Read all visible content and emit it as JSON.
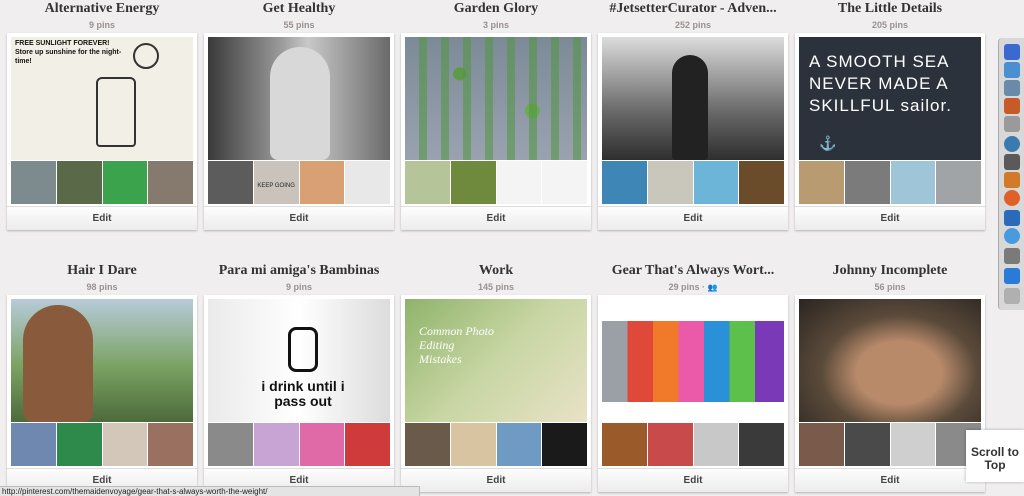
{
  "boards": [
    {
      "title": "Alternative Energy",
      "pins": "9 pins",
      "edit": "Edit",
      "cover_text": "FREE SUNLIGHT FOREVER! Store up sunshine for the night-time!"
    },
    {
      "title": "Get Healthy",
      "pins": "55 pins",
      "edit": "Edit",
      "thumb_text": "KEEP GOING"
    },
    {
      "title": "Garden Glory",
      "pins": "3 pins",
      "edit": "Edit"
    },
    {
      "title": "#JetsetterCurator - Adven...",
      "pins": "252 pins",
      "edit": "Edit"
    },
    {
      "title": "The Little Details",
      "pins": "205 pins",
      "edit": "Edit",
      "cover_text": "A SMOOTH SEA NEVER MADE A SKILLFUL sailor."
    },
    {
      "title": "Hair I Dare",
      "pins": "98 pins",
      "edit": "Edit"
    },
    {
      "title": "Para mi amiga's Bambinas",
      "pins": "9 pins",
      "edit": "Edit",
      "cover_text": "i drink until i pass out"
    },
    {
      "title": "Work",
      "pins": "145 pins",
      "edit": "Edit",
      "cover_text": "Common Photo Editing Mistakes"
    },
    {
      "title": "Gear That's Always Wort...",
      "pins": "29 pins ·",
      "edit": "Edit"
    },
    {
      "title": "Johnny Incomplete",
      "pins": "56 pins",
      "edit": "Edit"
    }
  ],
  "scroll_to_top": "Scroll to Top",
  "status_url": "http://pinterest.com/themaidenvoyage/gear-that-s-always-worth-the-weight/",
  "colors": {
    "background": "#f0eeee",
    "card": "#ffffff",
    "pins_text": "#9a9090"
  }
}
